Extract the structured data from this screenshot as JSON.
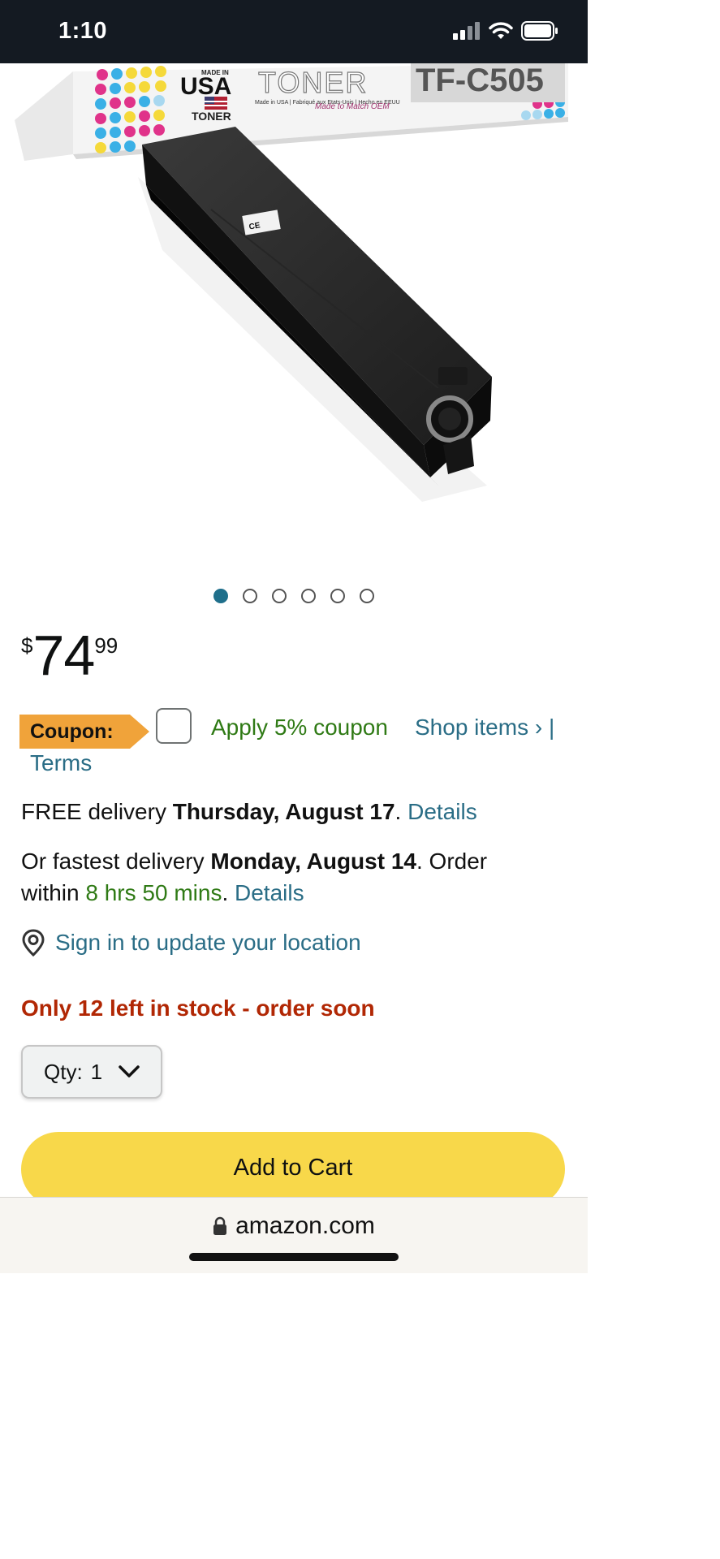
{
  "status_bar": {
    "time": "1:10"
  },
  "product_image": {
    "box_brand_top": "MADE IN",
    "box_brand_usa": "USA",
    "box_brand_toner_small": "TONER",
    "box_brand_toner": "TONER",
    "box_model": "TF-C505",
    "box_tagline": "Made in USA | Fabriqué aux Etats-Unis | Hecho en EEUU",
    "box_match": "Made to Match OEM"
  },
  "carousel": {
    "count": 6,
    "active_index": 0
  },
  "price": {
    "symbol": "$",
    "whole": "74",
    "fraction": "99"
  },
  "coupon": {
    "badge": "Coupon:",
    "apply_text": "Apply 5% coupon",
    "shop_items": "Shop items › |",
    "terms": "Terms"
  },
  "delivery": {
    "free_prefix": "FREE delivery ",
    "free_date": "Thursday, August 17",
    "free_period": ". ",
    "free_details": "Details",
    "fast_prefix": "Or fastest delivery ",
    "fast_date": "Monday, August 14",
    "fast_mid": ". Order",
    "fast_within": "within ",
    "fast_time": "8 hrs 50 mins",
    "fast_period": ". ",
    "fast_details": "Details"
  },
  "location": {
    "text": "Sign in to update your location"
  },
  "stock": {
    "text": "Only 12 left in stock - order soon"
  },
  "quantity": {
    "label": "Qty:",
    "value": "1"
  },
  "cart": {
    "button_label": "Add to Cart"
  },
  "browser": {
    "url": "amazon.com"
  },
  "colors": {
    "link": "#2a6d86",
    "green": "#2f7a15",
    "stock_red": "#b12704",
    "cart_yellow": "#f8d84a",
    "coupon_orange": "#f0a33a"
  }
}
